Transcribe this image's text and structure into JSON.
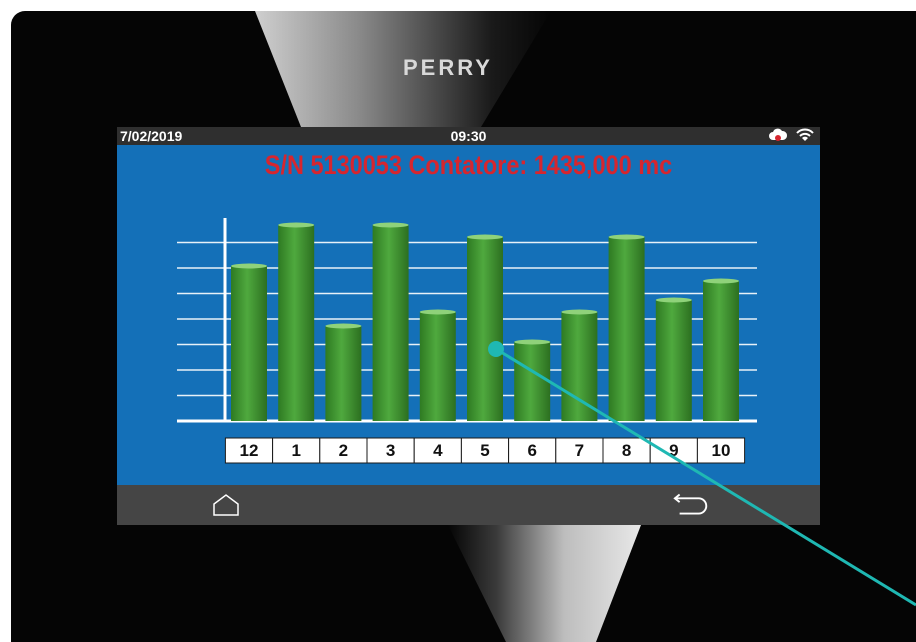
{
  "device": {
    "brand": "PERRY"
  },
  "status_bar": {
    "date": "7/02/2019",
    "time": "09:30",
    "icons": [
      "cloud-alert-icon",
      "wifi-icon"
    ]
  },
  "screen_title": "S/N 5130053 Contatore: 1435,000 mc",
  "chart_data": {
    "type": "bar",
    "categories": [
      "12",
      "1",
      "2",
      "3",
      "4",
      "5",
      "6",
      "7",
      "8",
      "9",
      "10"
    ],
    "values": [
      155,
      196,
      95,
      196,
      109,
      184,
      79,
      109,
      184,
      121,
      140
    ],
    "ylim": [
      0,
      200
    ],
    "grid": true,
    "bar_color": "#4fa93e",
    "background": "#1470b8"
  },
  "nav": {
    "icons": [
      "home-icon",
      "back-icon"
    ]
  },
  "colors": {
    "title": "#d6262f",
    "accent_pointer": "#1fb8b3"
  }
}
